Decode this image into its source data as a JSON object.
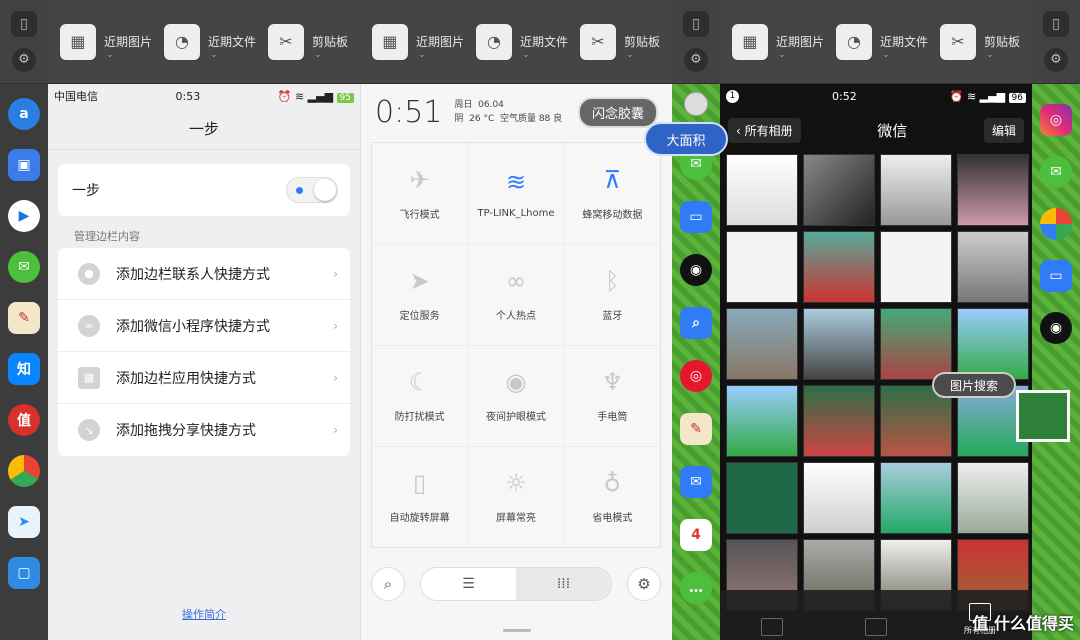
{
  "toolbar": {
    "recent_images": "近期图片",
    "recent_files": "近期文件",
    "clipboard": "剪贴板"
  },
  "phone1": {
    "status": {
      "carrier": "中国电信",
      "time": "0:53",
      "battery": "95"
    },
    "title": "一步",
    "toggle_label": "一步",
    "section_label": "管理边栏内容",
    "rows": [
      {
        "label": "添加边栏联系人快捷方式"
      },
      {
        "label": "添加微信小程序快捷方式"
      },
      {
        "label": "添加边栏应用快捷方式"
      },
      {
        "label": "添加拖拽分享快捷方式"
      }
    ],
    "footer_link": "操作简介"
  },
  "phone2": {
    "time": "0:51",
    "weekday": "周日",
    "date": "06.04",
    "weather": "阴",
    "temperature": "26 °C",
    "air_quality": "空气质量 88",
    "air_quality_level": "良",
    "capsule": "闪念胶囊",
    "tiles": [
      {
        "label": "飞行模式",
        "active": false
      },
      {
        "label": "TP-LINK_Lhome",
        "active": true
      },
      {
        "label": "蜂窝移动数据",
        "active": true
      },
      {
        "label": "定位服务",
        "active": false
      },
      {
        "label": "个人热点",
        "active": false
      },
      {
        "label": "蓝牙",
        "active": false
      },
      {
        "label": "防打扰模式",
        "active": false
      },
      {
        "label": "夜间护眼模式",
        "active": false
      },
      {
        "label": "手电筒",
        "active": false
      },
      {
        "label": "自动旋转屏幕",
        "active": false
      },
      {
        "label": "屏幕常亮",
        "active": false
      },
      {
        "label": "省电模式",
        "active": false
      }
    ]
  },
  "phone3": {
    "status": {
      "badge": "1",
      "time": "0:52",
      "battery": "96"
    },
    "back": "所有相册",
    "title": "微信",
    "edit": "编辑",
    "tabbar_active": "所有相册"
  },
  "overlays": {
    "big_area": "大面积",
    "image_search": "图片搜索"
  },
  "watermark": "值 什么值得买",
  "colors": {
    "accent": "#2f7cf6",
    "bubble": "#2f64c6"
  }
}
